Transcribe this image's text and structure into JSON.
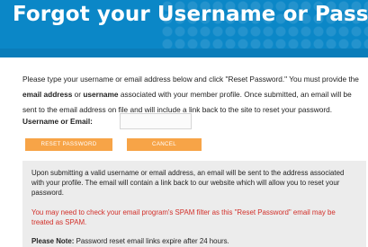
{
  "header": {
    "title": "Forgot your Username or Password?",
    "background_color": "#0b87c7"
  },
  "intro": {
    "text_1": "Please type your username or email address below and click \"Reset Password.\" You must provide the",
    "bold_email": "email address",
    "text_or": " or ",
    "bold_username": "username",
    "text_2": " associated with your member profile. Once submitted, an email will be sent to the email address on file and will include a link back to the site to reset your password."
  },
  "form": {
    "label": "Username or Email:",
    "value": "",
    "placeholder": ""
  },
  "buttons": {
    "reset_label": "RESET PASSWORD",
    "cancel_label": "CANCEL",
    "color": "#f7a447"
  },
  "notice": {
    "paragraph_1": "Upon submitting a valid username or email address, an email will be sent to the address associated with your profile. The email will contain a link back to our website which will allow you to reset your password.",
    "warning": "You may need to check your email program's SPAM filter as this \"Reset Password\" email may be treated as SPAM.",
    "warning_color": "#d2302a",
    "note_label": "Please Note:",
    "note_text": " Password reset email links expire after 24 hours."
  }
}
